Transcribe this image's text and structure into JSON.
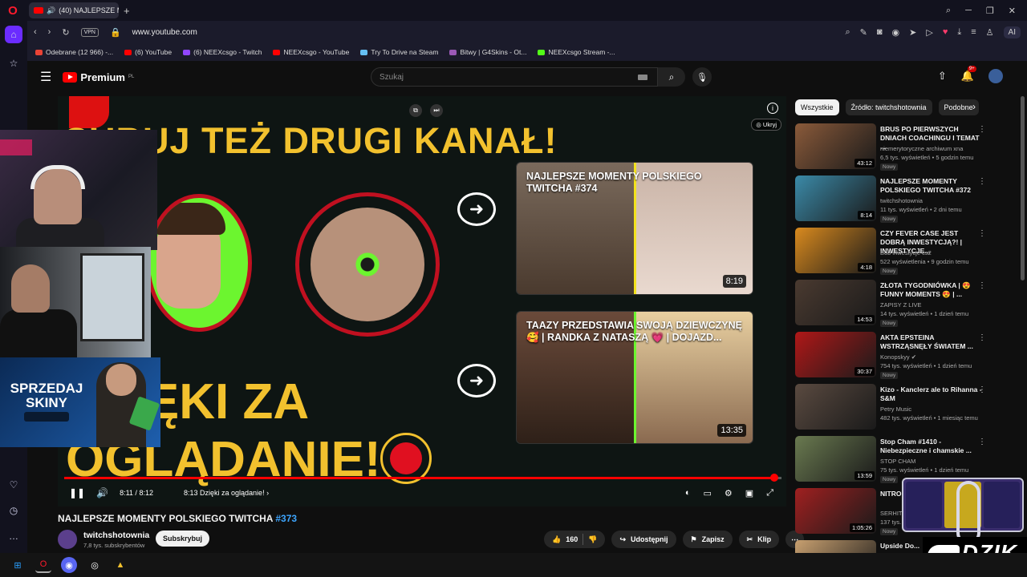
{
  "browser": {
    "tab_title": "(40) NAJLEPSZE MOM",
    "url": "www.youtube.com",
    "vpn_label": "VPN",
    "ai_label": "AI",
    "bookmarks": [
      {
        "label": "Odebrane (12 966) -...",
        "color": "#ea4335"
      },
      {
        "label": "(6) YouTube",
        "color": "#ff0000"
      },
      {
        "label": "(6) NEEXcsgo - Twitch",
        "color": "#9146ff"
      },
      {
        "label": "NEEXcsgo - YouTube",
        "color": "#ff0000"
      },
      {
        "label": "Try To Drive na Steam",
        "color": "#66c0f4"
      },
      {
        "label": "Bitwy | G4Skins - Ot...",
        "color": "#9b59b6"
      },
      {
        "label": "NEEXcsgo Stream -...",
        "color": "#53fc18"
      }
    ]
  },
  "youtube": {
    "logo_text": "Premium",
    "logo_sup": "PL",
    "search_placeholder": "Szukaj",
    "notifications_badge": "9+"
  },
  "player": {
    "end_title_top": "SUBUJ TEŻ DRUGI KANAŁ!",
    "end_title_bottom_1": "DZIĘKI ZA",
    "end_title_bottom_2": "OGLĄDANIE!",
    "hide_label": "Ukryj",
    "time_current": "8:11",
    "time_total": "8:12",
    "chapter_time": "8:13",
    "chapter_label": "Dzięki za oglądanie!",
    "progress": 0.99,
    "end_cards": [
      {
        "title": "NAJLEPSZE MOMENTY POLSKIEGO TWITCHA #374",
        "duration": "8:19"
      },
      {
        "title": "TAAZY PRZEDSTAWIA SWOJĄ DZIEWCZYNĘ 🥰 | RANDKA Z NATASZĄ 💗 | DOJAZD...",
        "duration": "13:35"
      }
    ]
  },
  "promo": {
    "text_line1": "SPRZEDAJ",
    "text_line2": "SKINY"
  },
  "video": {
    "title": "NAJLEPSZE MOMENTY POLSKIEGO TWITCHA",
    "title_tag": "#373",
    "channel": "twitchshotownia",
    "subscribers": "7,8 tys. subskrybentów",
    "subscribe_label": "Subskrybuj",
    "likes": "160",
    "share_label": "Udostępnij",
    "save_label": "Zapisz",
    "clip_label": "Klip"
  },
  "filters": [
    "Wszystkie",
    "Źródło: twitchshotownia",
    "Podobne"
  ],
  "recommendations": [
    {
      "title": "BRUS PO PIERWSZYCH DNIACH COACHINGU I TEMAT ...",
      "channel": "niemerytoryczne archiwum xna",
      "meta": "6,5 tys. wyświetleń • 5 godzin temu",
      "duration": "43:12",
      "is_new": "Nowy",
      "color": "#8a5a3a"
    },
    {
      "title": "NAJLEPSZE MOMENTY POLSKIEGO TWITCHA #372",
      "channel": "twitchshotownia",
      "meta": "11 tys. wyświetleń • 2 dni temu",
      "duration": "8:14",
      "is_new": "Nowy",
      "color": "#3b8aa8"
    },
    {
      "title": "CZY FEVER CASE JEST DOBRĄ INWESTYCJĄ?! | INWESTYCJE...",
      "channel": "Bob inwestycje cs2",
      "meta": "522 wyświetlenia • 9 godzin temu",
      "duration": "4:18",
      "is_new": "Nowy",
      "color": "#d98a1e"
    },
    {
      "title": "ZŁOTA TYGODNIÓWKA | 😍 FUNNY MOMENTS 😍 | ...",
      "channel": "ZAPISY Z LIVE",
      "meta": "14 tys. wyświetleń • 1 dzień temu",
      "duration": "14:53",
      "is_new": "Nowy",
      "color": "#4a3a30"
    },
    {
      "title": "AKTA EPSTEINA WSTRZĄSNĘŁY ŚWIATEM ...",
      "channel": "Konopskyy ✔",
      "meta": "754 tys. wyświetleń • 1 dzień temu",
      "duration": "30:37",
      "is_new": "Nowy",
      "color": "#b01818"
    },
    {
      "title": "Kizo - Kanclerz ale to Rihanna - S&M",
      "channel": "Petry Music",
      "meta": "482 tys. wyświetleń • 1 miesiąc temu",
      "duration": "",
      "is_new": "",
      "color": "#5a4a40"
    },
    {
      "title": "Stop Cham #1410 - Niebezpieczne i chamskie ...",
      "channel": "STOP CHAM",
      "meta": "75 tys. wyświetleń • 1 dzień temu",
      "duration": "13:59",
      "is_new": "Nowy",
      "color": "#6a7a50"
    },
    {
      "title": "NITRO O... DENISO...",
      "channel": "SERHITO",
      "meta": "137 tys. ...",
      "duration": "1:05:26",
      "is_new": "Nowy",
      "color": "#a02020"
    },
    {
      "title": "Upside Do...",
      "channel": "",
      "meta": "",
      "duration": "",
      "is_new": "",
      "color": "#c8a070"
    }
  ],
  "overlay": {
    "brand": "DZIK"
  },
  "colors": {
    "accent_yellow": "#f2c12e",
    "yt_red": "#ff0000",
    "link_blue": "#3ea6ff"
  }
}
